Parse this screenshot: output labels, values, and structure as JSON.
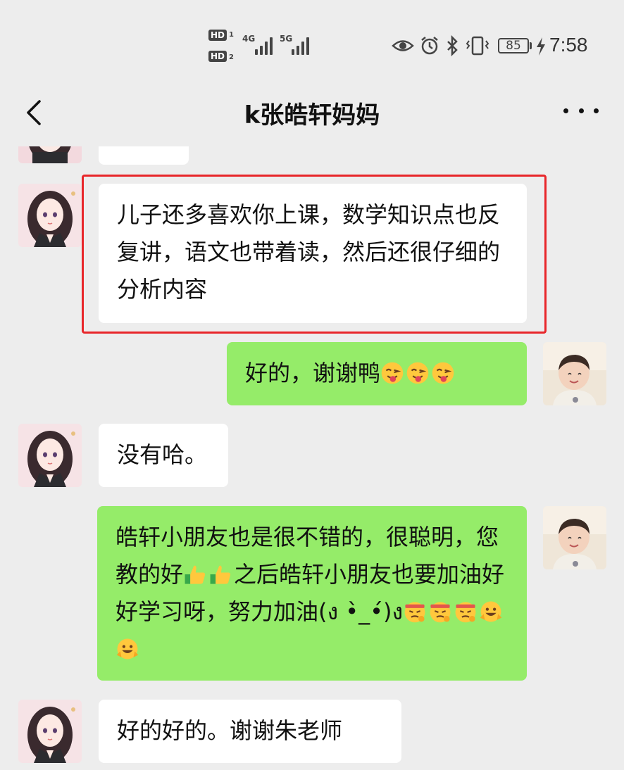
{
  "status_bar": {
    "hd1": "HD",
    "hd1_sub": "1",
    "hd2": "HD",
    "hd2_sub": "2",
    "net1": "4G",
    "net2": "5G",
    "battery": "85",
    "time": "7:58",
    "icons": [
      "eye-icon",
      "alarm-icon",
      "bluetooth-icon",
      "vibrate-icon",
      "battery-icon",
      "charging-icon"
    ]
  },
  "header": {
    "title": "k张皓轩妈妈",
    "back_icon": "chevron-left-icon",
    "more_icon": "more-dots-icon"
  },
  "messages": [
    {
      "side": "in",
      "text": ""
    },
    {
      "side": "in",
      "text": "儿子还多喜欢你上课，数学知识点也反复讲，语文也带着读，然后还很仔细的分析内容",
      "highlighted": true
    },
    {
      "side": "out",
      "text": "好的，谢谢鸭",
      "emojis": [
        "wink-tongue-emoji",
        "wink-tongue-emoji",
        "wink-tongue-emoji"
      ]
    },
    {
      "side": "in",
      "text": "没有哈。"
    },
    {
      "side": "out",
      "text": "皓轩小朋友也是很不错的，很聪明，您教的好",
      "text2": "之后皓轩小朋友也要加油好好学习呀，努力加油(ง •̀_•́)ง",
      "emojis": [
        "thumbs-up-emoji",
        "thumbs-up-emoji",
        "determined-emoji",
        "determined-emoji",
        "determined-emoji",
        "grin-emoji",
        "grin-emoji"
      ]
    },
    {
      "side": "in",
      "text": "好的好的。谢谢朱老师"
    }
  ],
  "colors": {
    "background": "#ededed",
    "incoming_bubble": "#ffffff",
    "outgoing_bubble": "#95ec69",
    "highlight_border": "#e8262a"
  }
}
